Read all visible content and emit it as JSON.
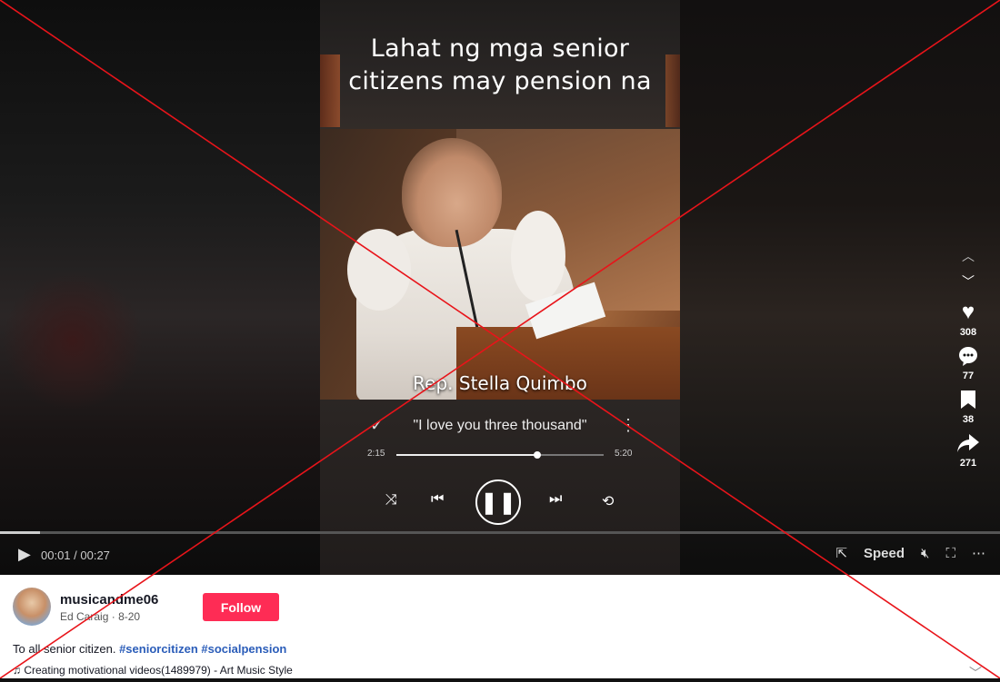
{
  "video": {
    "caption_line1": "Lahat ng mga senior",
    "caption_line2": "citizens may pension na",
    "name_tag": "Rep. Stella Quimbo",
    "song_title": "\"I love you three thousand\"",
    "song_time_current": "2:15",
    "song_time_total": "5:20",
    "song_progress": 0.68
  },
  "actions": {
    "likes": "308",
    "comments": "77",
    "saves": "38",
    "shares": "271"
  },
  "controls": {
    "time": "00:01 / 00:27",
    "progress": 0.04,
    "speed_label": "Speed"
  },
  "author": {
    "username": "musicandme06",
    "display_name": "Ed Caraig",
    "date": "8-20",
    "follow_label": "Follow"
  },
  "description": {
    "text": "To all senior citizen.",
    "tags": [
      "#seniorcitizen",
      "#socialpension"
    ]
  },
  "music": {
    "label": "Creating motivational videos(1489979) - Art Music Style"
  },
  "icons": {
    "like": "heart-icon",
    "comment": "comment-icon",
    "save": "bookmark-icon",
    "share": "share-icon"
  },
  "colors": {
    "follow": "#fe2c55",
    "tag": "#2b5db9",
    "overlay_x": "#e8141a"
  }
}
